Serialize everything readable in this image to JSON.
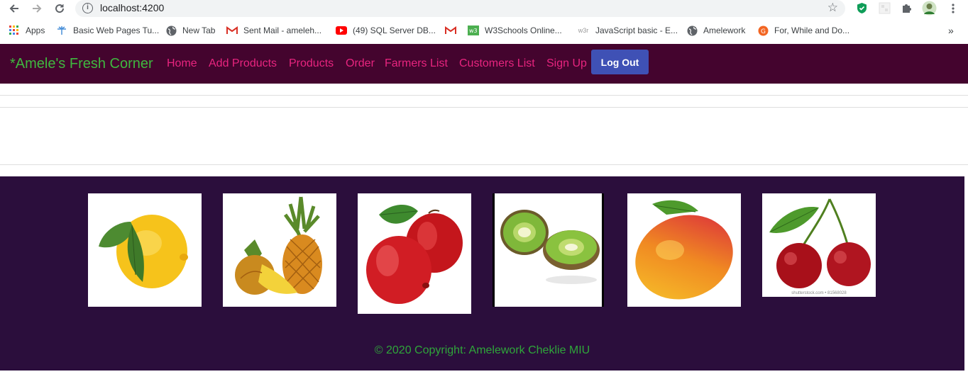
{
  "browser": {
    "url": "localhost:4200",
    "bookmarks": [
      {
        "label": "Apps",
        "icon": "apps-grid-icon"
      },
      {
        "label": "Basic Web Pages Tu...",
        "icon": "web-pages-icon"
      },
      {
        "label": "New Tab",
        "icon": "globe-icon"
      },
      {
        "label": "Sent Mail - ameleh...",
        "icon": "gmail-icon"
      },
      {
        "label": "(49) SQL Server DB...",
        "icon": "youtube-icon"
      },
      {
        "label": "",
        "icon": "gmail-icon"
      },
      {
        "label": "W3Schools Online...",
        "icon": "w3schools-icon"
      },
      {
        "label": "JavaScript basic - E...",
        "icon": "w3resource-icon"
      },
      {
        "label": "Amelework",
        "icon": "globe-icon"
      },
      {
        "label": "For, While and Do...",
        "icon": "guru-icon"
      }
    ],
    "more": "»"
  },
  "header": {
    "brand": "*Amele's Fresh Corner",
    "nav": [
      "Home",
      "Add Products",
      "Products",
      "Order",
      "Farmers List",
      "Customers List",
      "Sign Up"
    ],
    "logout": "Log Out"
  },
  "footer": {
    "fruits": [
      "lemon-image",
      "pineapple-image",
      "apples-image",
      "kiwi-image",
      "mango-image",
      "cherries-image"
    ],
    "watermark": "shutterstock.com • 81568028",
    "copyright": "© 2020 Copyright: Amelework Cheklie MIU"
  },
  "colors": {
    "header_bg": "#44042e",
    "brand": "#3fb83f",
    "nav_link": "#e8247f",
    "logout_bg": "#3f51b5",
    "footer_bg": "#2b0e3c",
    "copyright": "#2fa63a"
  }
}
